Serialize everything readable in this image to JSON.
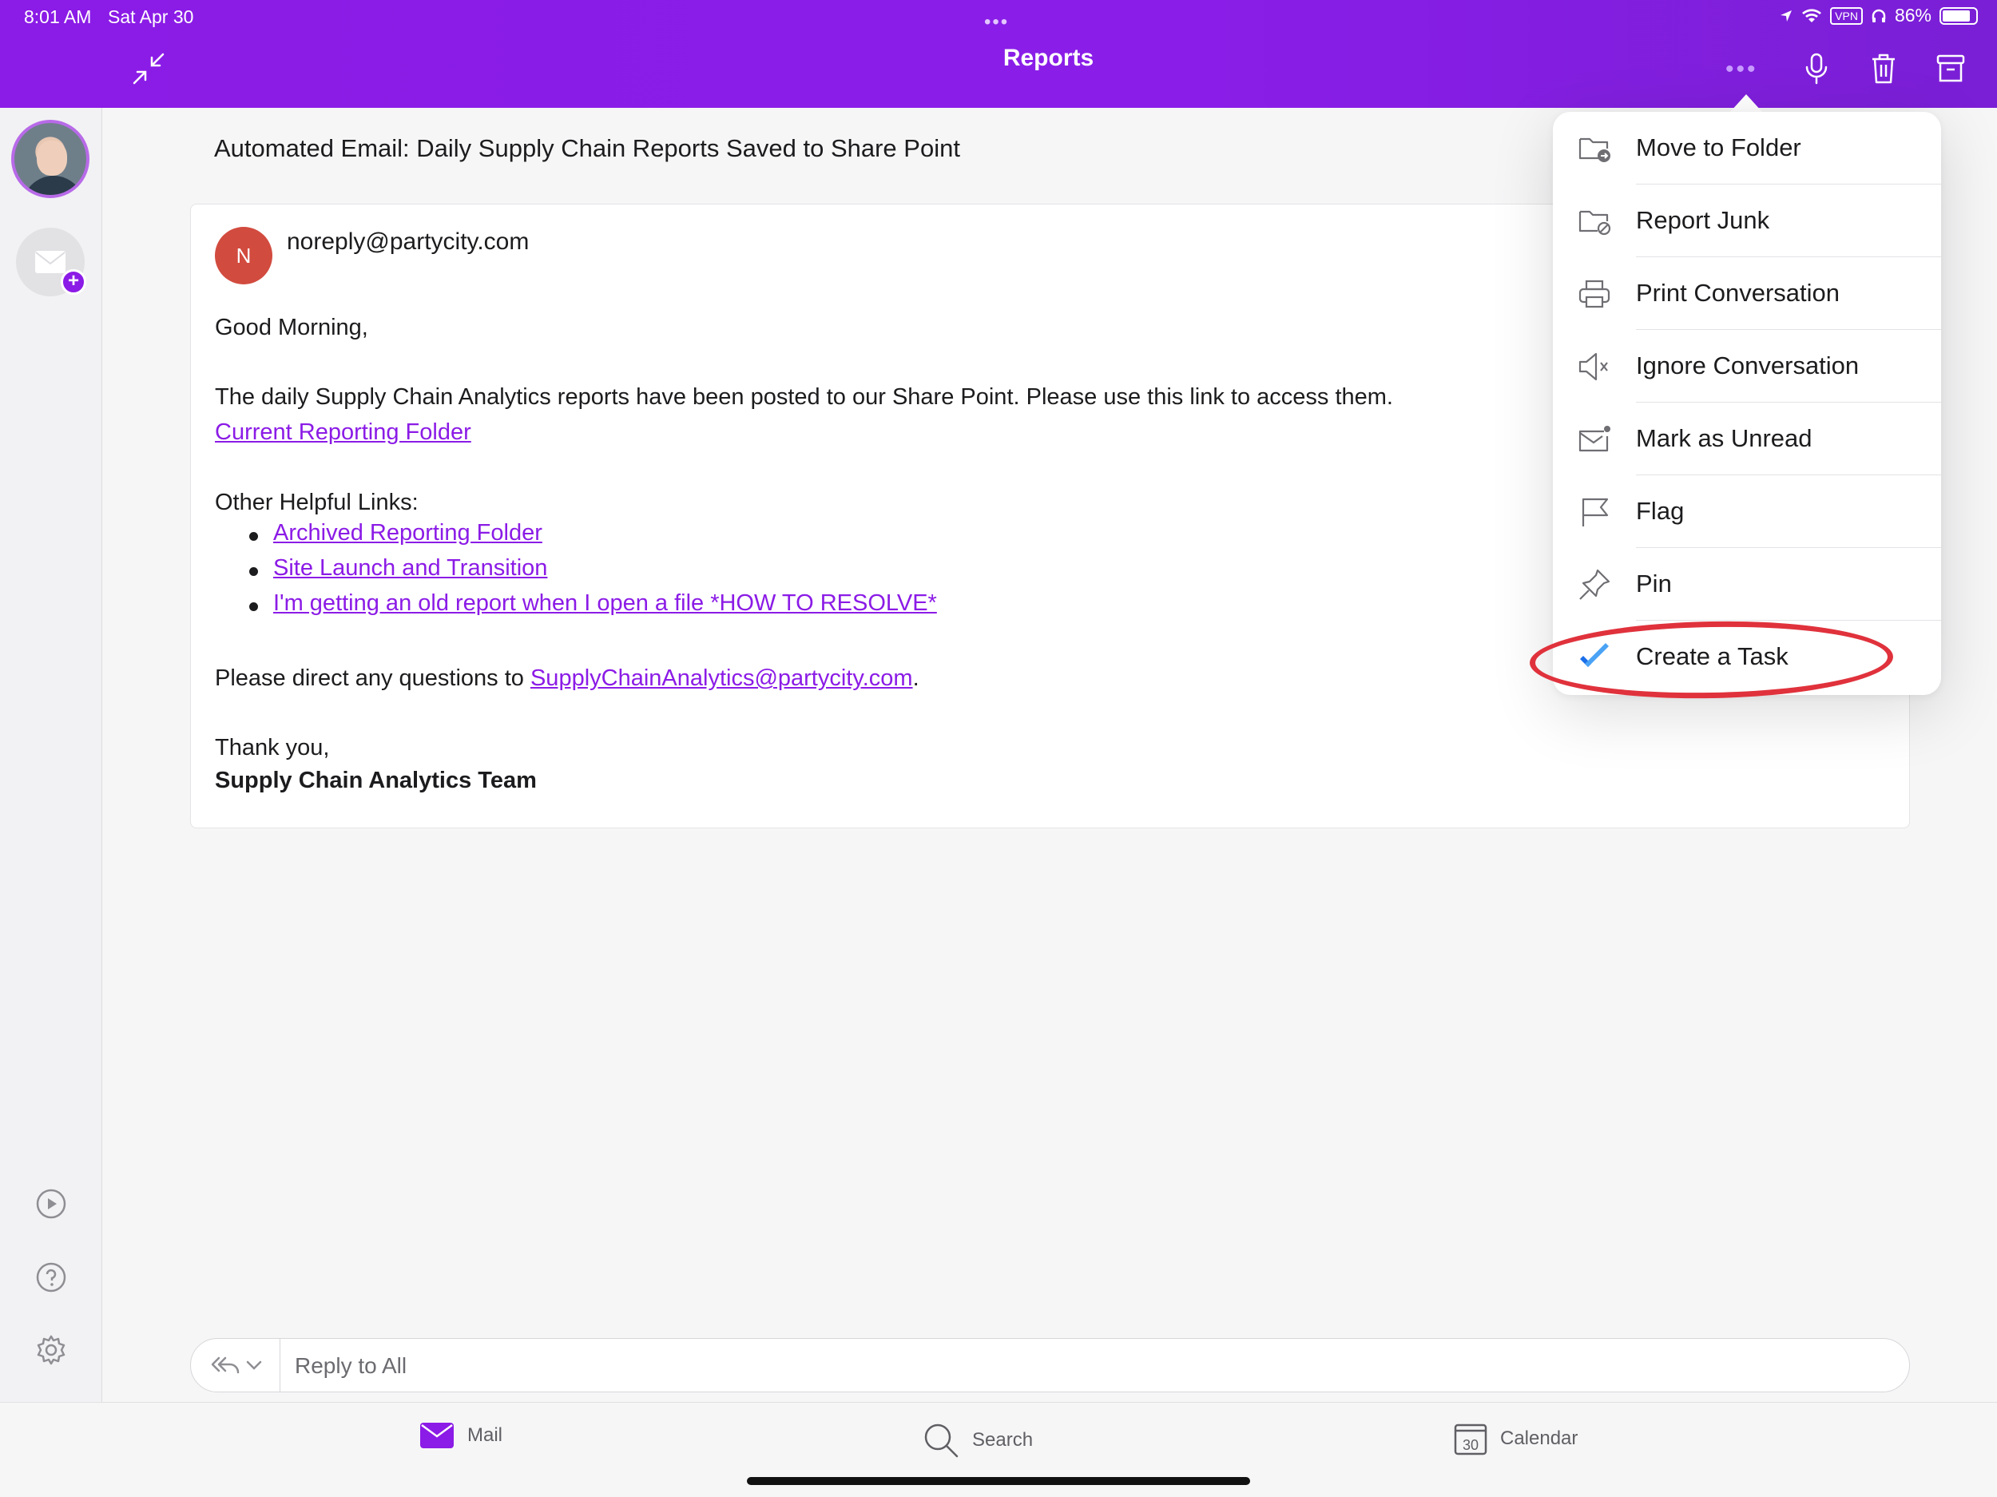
{
  "status_bar": {
    "time": "8:01 AM",
    "date": "Sat Apr 30",
    "vpn": "VPN",
    "battery": "86%",
    "battery_level": 0.86
  },
  "header": {
    "title": "Reports"
  },
  "email": {
    "subject": "Automated Email: Daily Supply Chain Reports Saved to Share Point",
    "sender_initial": "N",
    "sender": "noreply@partycity.com",
    "greeting": "Good Morning,",
    "intro": "The daily Supply Chain Analytics reports have been posted to our Share Point. Please use this link to access them.",
    "current_folder_link": "Current Reporting Folder",
    "other_links_heading": "Other Helpful Links:",
    "links": [
      "Archived Reporting Folder",
      "Site Launch and Transition",
      "I'm getting an old report when I open a file *HOW TO RESOLVE*"
    ],
    "questions_prefix": "Please direct any questions to ",
    "questions_email": "SupplyChainAnalytics@partycity.com",
    "questions_suffix": ".",
    "thanks": "Thank you,",
    "signature": "Supply Chain Analytics Team"
  },
  "menu": {
    "items": [
      {
        "label": "Move to Folder",
        "icon": "folder-move-icon"
      },
      {
        "label": "Report Junk",
        "icon": "folder-junk-icon"
      },
      {
        "label": "Print Conversation",
        "icon": "printer-icon"
      },
      {
        "label": "Ignore Conversation",
        "icon": "speaker-mute-icon"
      },
      {
        "label": "Mark as Unread",
        "icon": "envelope-unread-icon"
      },
      {
        "label": "Flag",
        "icon": "flag-icon"
      },
      {
        "label": "Pin",
        "icon": "pin-icon"
      },
      {
        "label": "Create a Task",
        "icon": "checkmark-icon"
      }
    ]
  },
  "reply": {
    "placeholder": "Reply to All"
  },
  "tabs": [
    {
      "label": "Mail",
      "icon": "mail-icon",
      "active": true
    },
    {
      "label": "Search",
      "icon": "search-icon",
      "active": false
    },
    {
      "label": "Calendar",
      "icon": "calendar-icon",
      "active": false
    }
  ],
  "calendar_day": "30",
  "colors": {
    "brand": "#8b1be6",
    "link": "#8b1be6",
    "sender_avatar": "#d24b3f",
    "annotation": "#e0323c"
  }
}
